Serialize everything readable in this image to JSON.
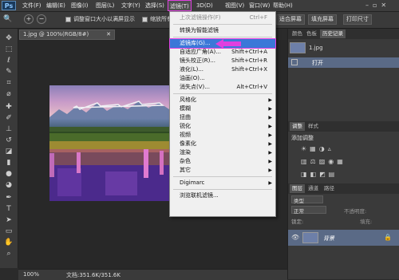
{
  "menubar": {
    "logo": "Ps",
    "items": [
      "文件(F)",
      "编辑(E)",
      "图像(I)",
      "图层(L)",
      "文字(Y)",
      "选择(S)",
      "滤镜(T)",
      "3D(D)",
      "视图(V)",
      "窗口(W)",
      "帮助(H)"
    ],
    "active_index": 6
  },
  "options_bar": {
    "checkbox1_label": "调整窗口大小以满屏显示",
    "checkbox2_label": "缩放所有",
    "fit_screen_label": "适合屏幕",
    "fill_screen_label": "填充屏幕",
    "print_size_label": "打印尺寸"
  },
  "document": {
    "tab_title": "1.jpg @ 100%(RGB/8#)",
    "zoom": "100%",
    "doc_info": "文档:351.6K/351.6K"
  },
  "filter_menu": {
    "items": [
      {
        "label": "上次滤镜操作(F)",
        "shortcut": "Ctrl+F",
        "disabled": true
      },
      {
        "sep": true
      },
      {
        "label": "转换为智能滤镜"
      },
      {
        "sep": true
      },
      {
        "label": "滤镜库(G)...",
        "highlight": true
      },
      {
        "label": "自适应广角(A)...",
        "shortcut": "Shift+Ctrl+A"
      },
      {
        "label": "镜头校正(R)...",
        "shortcut": "Shift+Ctrl+R"
      },
      {
        "label": "液化(L)...",
        "shortcut": "Shift+Ctrl+X"
      },
      {
        "label": "油画(O)..."
      },
      {
        "label": "消失点(V)...",
        "shortcut": "Alt+Ctrl+V"
      },
      {
        "sep": true
      },
      {
        "label": "风格化",
        "sub": true
      },
      {
        "label": "模糊",
        "sub": true
      },
      {
        "label": "扭曲",
        "sub": true
      },
      {
        "label": "锐化",
        "sub": true
      },
      {
        "label": "视频",
        "sub": true
      },
      {
        "label": "像素化",
        "sub": true
      },
      {
        "label": "渲染",
        "sub": true
      },
      {
        "label": "杂色",
        "sub": true
      },
      {
        "label": "其它",
        "sub": true
      },
      {
        "sep": true
      },
      {
        "label": "Digimarc",
        "sub": true
      },
      {
        "sep": true
      },
      {
        "label": "浏览联机滤镜..."
      }
    ]
  },
  "history_panel": {
    "tabs": [
      "颜色",
      "色板",
      "历史记录"
    ],
    "active_tab": 2,
    "snapshot_name": "1.jpg",
    "step": "打开"
  },
  "adjustments_panel": {
    "tabs": [
      "调整",
      "样式"
    ],
    "title": "添加调整"
  },
  "layers_panel": {
    "tabs": [
      "图层",
      "通道",
      "路径"
    ],
    "kind": "类型",
    "blend_mode": "正常",
    "opacity_label": "不透明度:",
    "lock_label": "锁定:",
    "fill_label": "填充:",
    "layer_name": "背景"
  },
  "colors": {
    "menu_highlight": "#3b78d8",
    "annotation": "#e040e0"
  }
}
